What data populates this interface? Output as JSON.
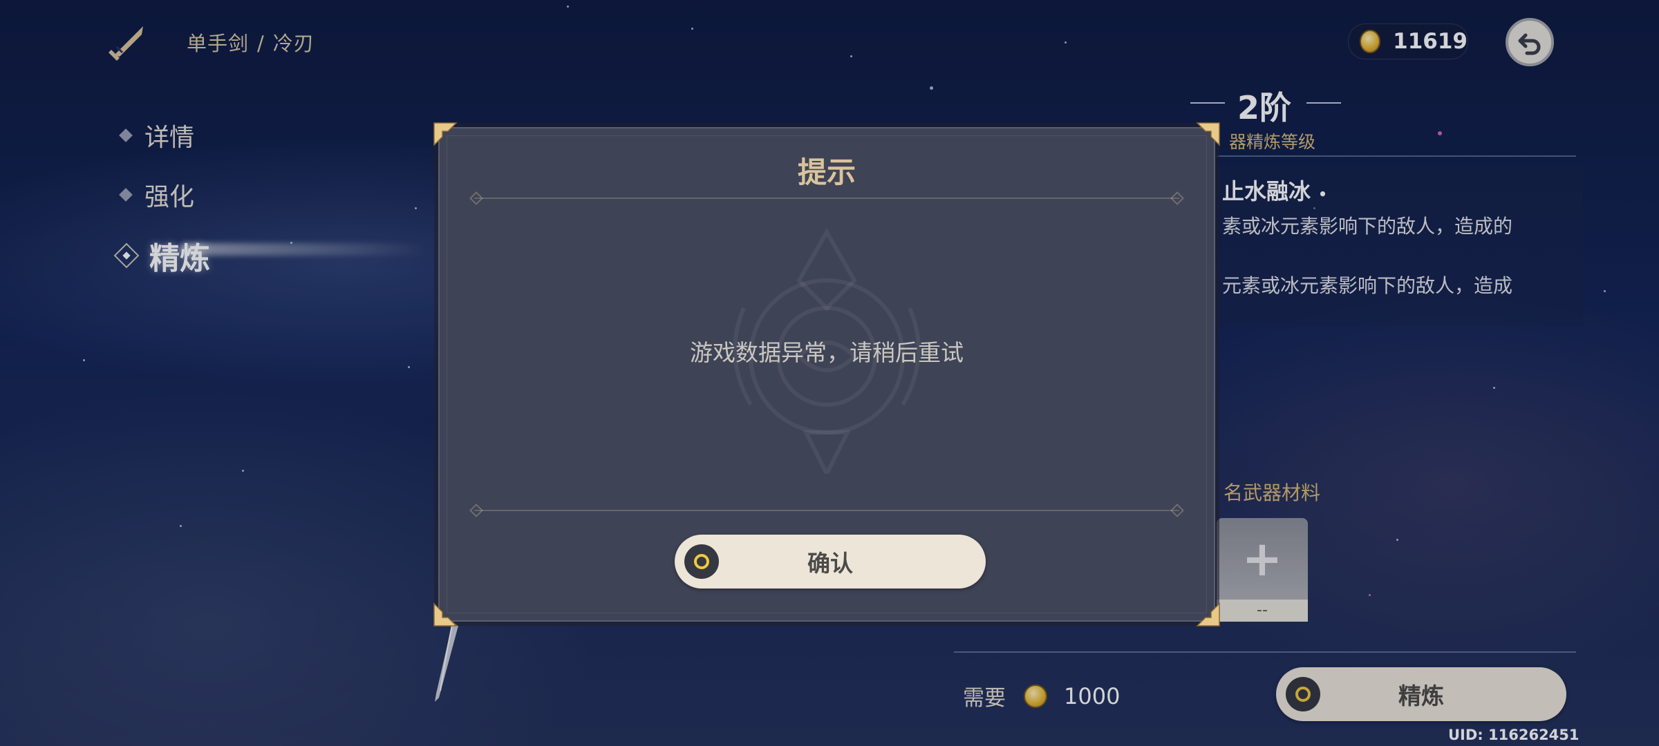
{
  "header": {
    "weapon_type": "单手剑",
    "separator": "/",
    "weapon_name": "冷刃",
    "mora": "11619"
  },
  "nav": {
    "items": [
      {
        "label": "详情"
      },
      {
        "label": "强化"
      },
      {
        "label": "精炼",
        "active": true
      }
    ]
  },
  "refine_panel": {
    "rank": "2阶",
    "level_label": "器精炼等级",
    "skill_title": "止水融冰",
    "desc_line1": "素或冰元素影响下的敌人，造成的",
    "desc_line2": "元素或冰元素影响下的敌人，造成",
    "material_label": "名武器材料",
    "slot_placeholder": "--",
    "cost_label": "需要",
    "cost_amount": "1000",
    "refine_button": "精炼",
    "uid": "UID: 116262451"
  },
  "dialog": {
    "title": "提示",
    "message": "游戏数据异常，请稍后重试",
    "confirm_button": "确认"
  },
  "colors": {
    "accent_gold": "#d9c49a",
    "button_bg": "#ece5d8",
    "dialog_bg": "#3f4356"
  }
}
